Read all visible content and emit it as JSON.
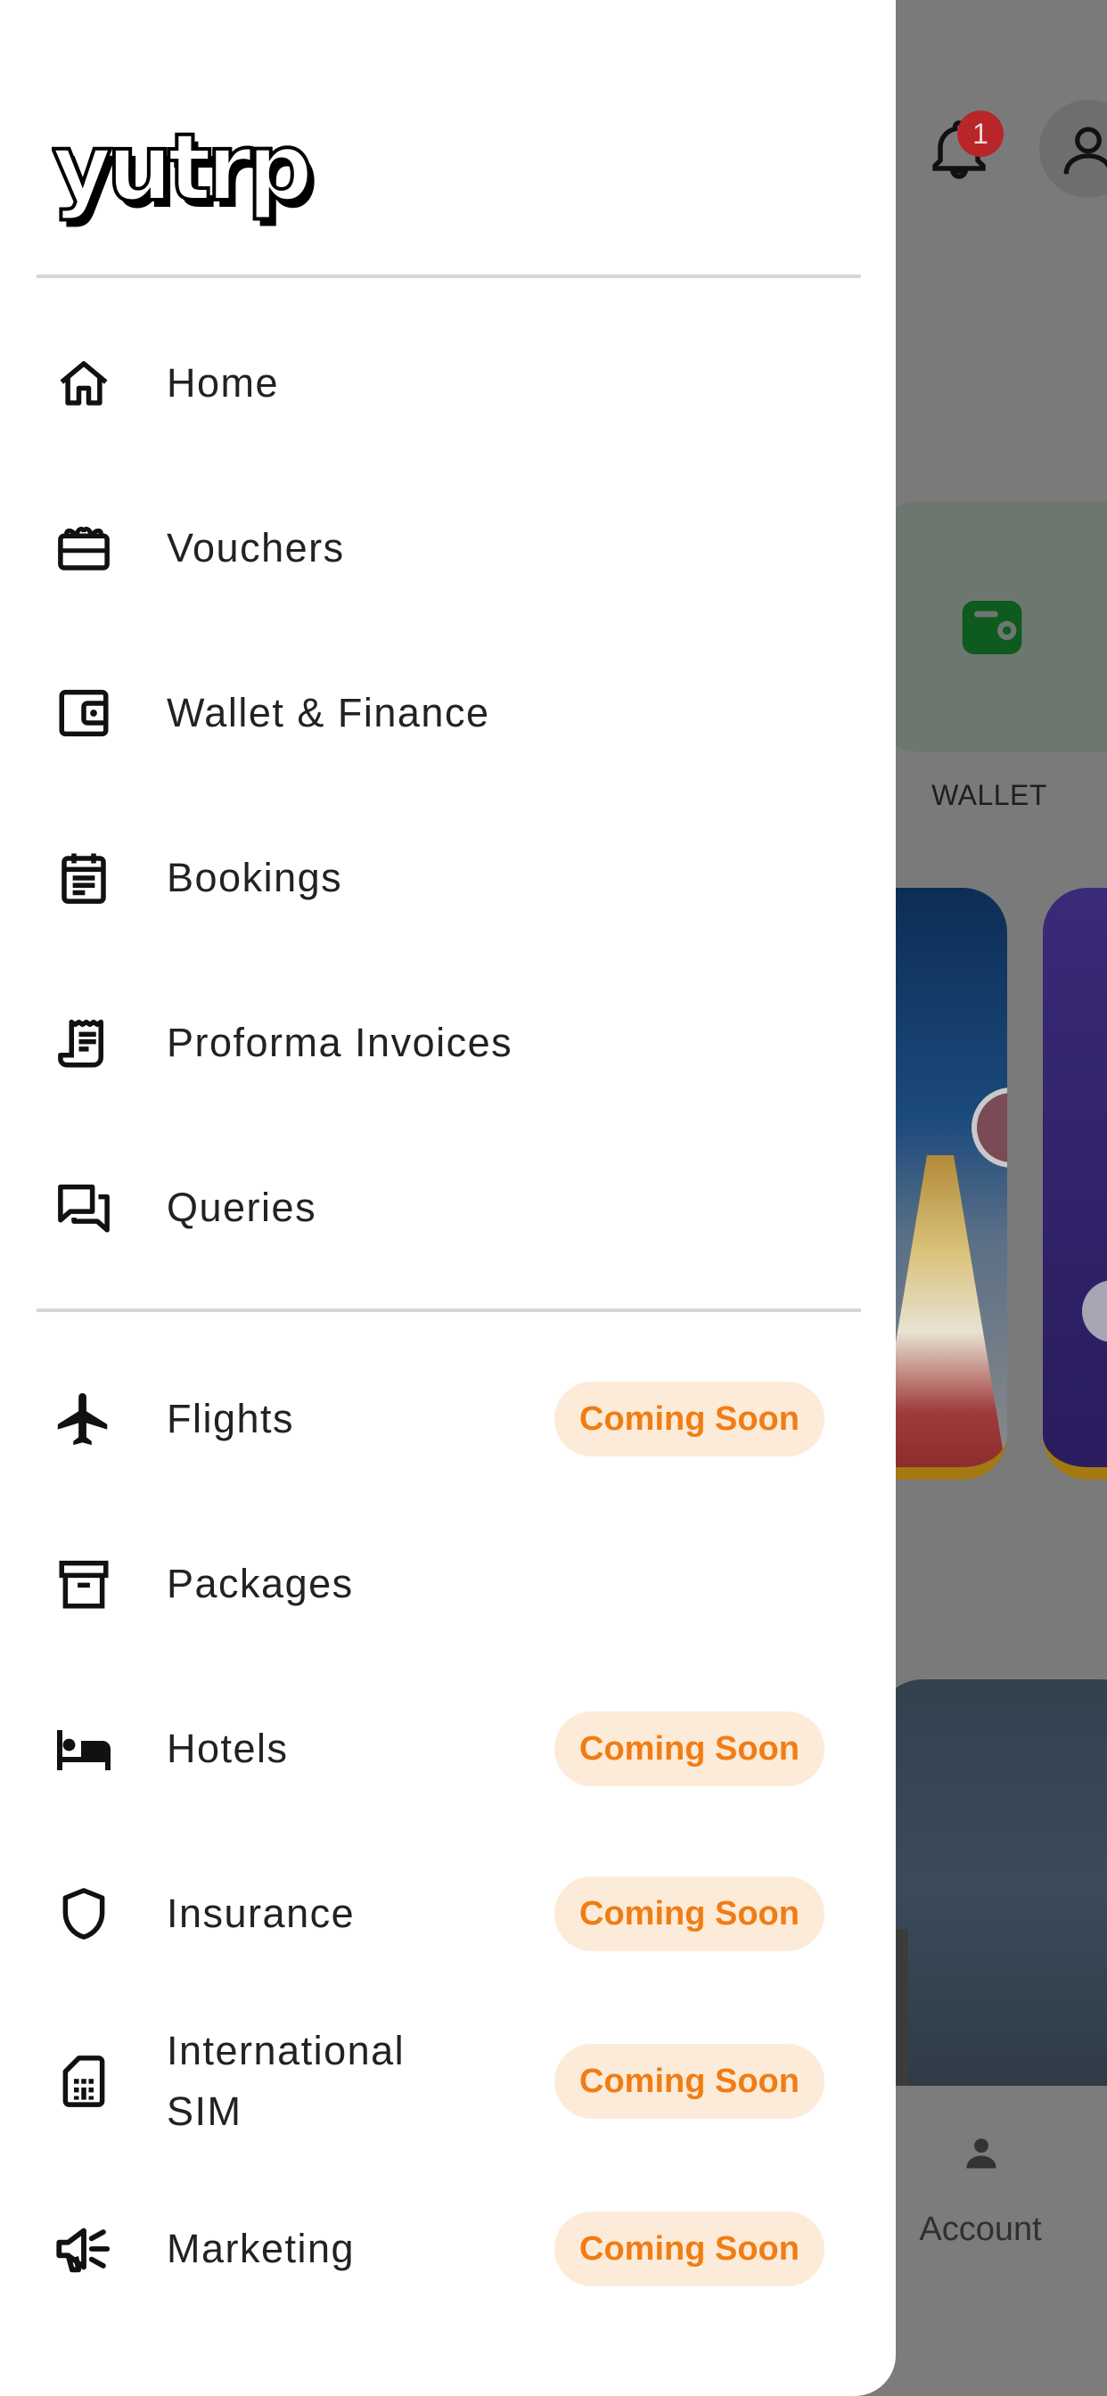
{
  "app": {
    "logo_text": "yutrp"
  },
  "drawer": {
    "primary_items": [
      {
        "label": "Home",
        "icon": "home-icon"
      },
      {
        "label": "Vouchers",
        "icon": "gift-card-icon"
      },
      {
        "label": "Wallet & Finance",
        "icon": "wallet-icon"
      },
      {
        "label": "Bookings",
        "icon": "calendar-list-icon"
      },
      {
        "label": "Proforma Invoices",
        "icon": "receipt-icon"
      },
      {
        "label": "Queries",
        "icon": "chat-bubbles-icon"
      }
    ],
    "service_items": [
      {
        "label": "Flights",
        "icon": "airplane-icon",
        "badge": "Coming Soon"
      },
      {
        "label": "Packages",
        "icon": "archive-box-icon",
        "badge": ""
      },
      {
        "label": "Hotels",
        "icon": "bed-icon",
        "badge": "Coming Soon"
      },
      {
        "label": "Insurance",
        "icon": "shield-icon",
        "badge": "Coming Soon"
      },
      {
        "label": "International SIM",
        "label_line1": "International",
        "label_line2": "SIM",
        "icon": "sim-card-icon",
        "badge": "Coming Soon"
      },
      {
        "label": "Marketing",
        "icon": "megaphone-icon",
        "badge": "Coming Soon"
      }
    ]
  },
  "background": {
    "notification_count": "1",
    "wallet_label": "WALLET",
    "account_label": "Account"
  },
  "colors": {
    "badge_text": "#f07d14",
    "badge_bg": "#fdebd9",
    "notification_badge": "#b8262a",
    "wallet_icon": "#0f5a1f"
  }
}
